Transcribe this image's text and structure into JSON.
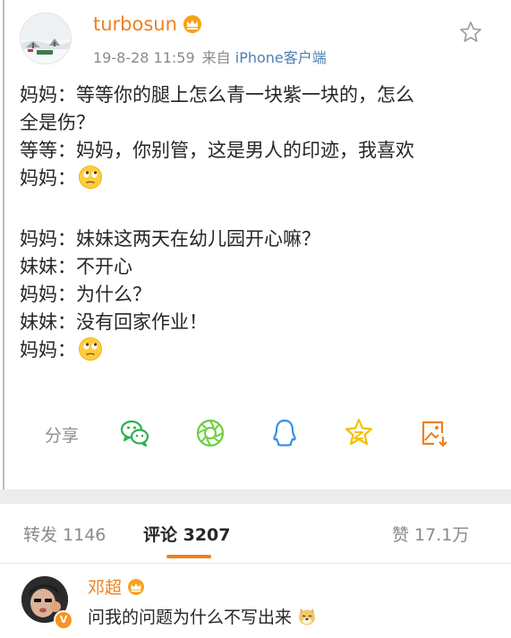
{
  "post": {
    "username": "turbosun",
    "timestamp": "19-8-28 11:59",
    "source_prefix": "来自",
    "source": "iPhone客户端",
    "lines": [
      {
        "text": "妈妈：等等你的腿上怎么青一块紫一块的，怎么",
        "emoji": ""
      },
      {
        "text": "全是伤？",
        "emoji": ""
      },
      {
        "text": "等等：妈妈，你别管，这是男人的印迹，我喜欢",
        "emoji": ""
      },
      {
        "text": "妈妈：",
        "emoji": "eye-roll"
      },
      {
        "text": "",
        "emoji": ""
      },
      {
        "text": "妈妈：妹妹这两天在幼儿园开心嘛？",
        "emoji": ""
      },
      {
        "text": "妹妹：不开心",
        "emoji": ""
      },
      {
        "text": "妈妈：为什么？",
        "emoji": ""
      },
      {
        "text": "妹妹：没有回家作业！",
        "emoji": ""
      },
      {
        "text": "妈妈：",
        "emoji": "eye-roll"
      }
    ]
  },
  "share": {
    "label": "分享",
    "icons": [
      "wechat-icon",
      "moments-icon",
      "qq-icon",
      "qzone-star-icon",
      "save-image-icon"
    ]
  },
  "tabs": {
    "repost": "转发 1146",
    "comments": "评论 3207",
    "likes": "赞 17.1万"
  },
  "comment": {
    "username": "邓超",
    "text": "问我的问题为什么不写出来",
    "badge": "V"
  },
  "colors": {
    "accent": "#f07f1d",
    "link": "#4d7fb0",
    "wechat": "#2bb24c",
    "moments": "#6ccf3a",
    "qq": "#3a8ee6",
    "qzone": "#f5c000",
    "save": "#f07f1d"
  }
}
